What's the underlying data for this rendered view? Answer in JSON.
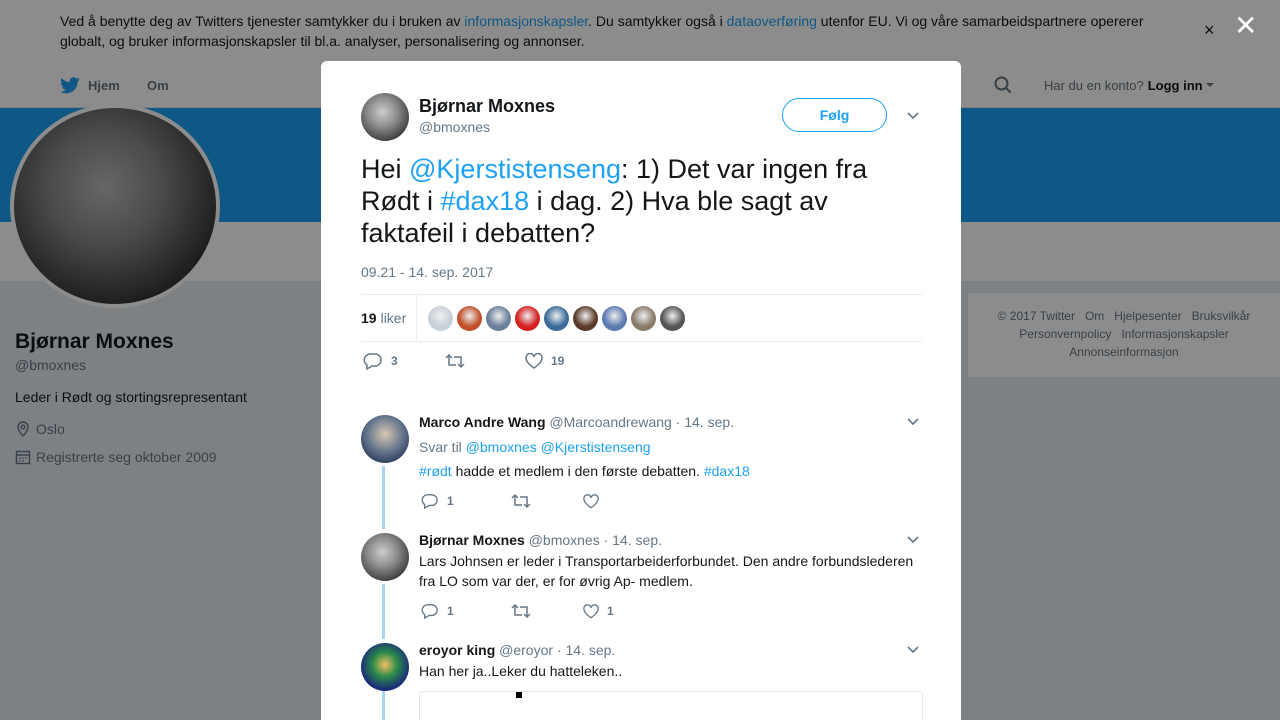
{
  "cookie": {
    "text_before": "Ved å benytte deg av Twitters tjenester samtykker du i bruken av ",
    "link1": "informasjonskapsler",
    "text_mid": ". Du samtykker også i ",
    "link2": "dataoverføring",
    "text_after": " utenfor EU. Vi og våre samarbeidspartnere opererer globalt, og bruker informasjonskapsler til bl.a. analyser, personalisering og annonser.",
    "close": "×"
  },
  "nav": {
    "home": "Hjem",
    "about": "Om",
    "account_prompt": "Har du en konto?",
    "login": "Logg inn"
  },
  "profile": {
    "name": "Bjørnar Moxnes",
    "handle": "@bmoxnes",
    "bio": "Leder i Rødt og stortingsrepresentant",
    "location": "Oslo",
    "joined": "Registrerte seg oktober 2009"
  },
  "footer": {
    "row1": [
      "© 2017 Twitter",
      "Om",
      "Hjelpesenter",
      "Bruksvilkår"
    ],
    "row2": [
      "Personvernpolicy",
      "Informasjonskapsler"
    ],
    "row3": [
      "Annonseinformasjon"
    ]
  },
  "overlay": {
    "close": "✕"
  },
  "tweet": {
    "name": "Bjørnar Moxnes",
    "handle": "@bmoxnes",
    "follow": "Følg",
    "text_1": "Hei ",
    "mention": "@Kjerstistenseng",
    "text_2": ": 1) Det var ingen fra Rødt i ",
    "hashtag": "#dax18",
    "text_3": " i dag. 2) Hva ble sagt av faktafeil i debatten?",
    "date": "09.21 - 14. sep. 2017",
    "likes_count": "19",
    "likes_label": "liker",
    "reply_count": "3",
    "retweet_count": "",
    "like_count": "19",
    "liker_colors": [
      "#c8d0d8",
      "#c0502a",
      "#6a7f9a",
      "#d42020",
      "#3a6a9a",
      "#5a3a2a",
      "#5a7ab0",
      "#8a7a6a",
      "#555555"
    ]
  },
  "replies": [
    {
      "name": "Marco Andre Wang",
      "handle": "@Marcoandrewang",
      "date": "· 14. sep.",
      "reply_to_label": "Svar til",
      "reply_to": "@bmoxnes @Kjerstistenseng",
      "tag1": "#rødt",
      "text": " hadde et medlem i den første debatten. ",
      "tag2": "#dax18",
      "reply_count": "1",
      "like_count": ""
    },
    {
      "name": "Bjørnar Moxnes",
      "handle": "@bmoxnes",
      "date": "· 14. sep.",
      "text": "Lars Johnsen er leder i Transportarbeiderforbundet. Den andre forbundslederen fra LO som var der, er for øvrig Ap- medlem.",
      "reply_count": "1",
      "like_count": "1"
    },
    {
      "name": "eroyor king",
      "handle": "@eroyor",
      "date": "· 14. sep.",
      "text": "Han her ja..Leker du hatteleken.."
    }
  ]
}
